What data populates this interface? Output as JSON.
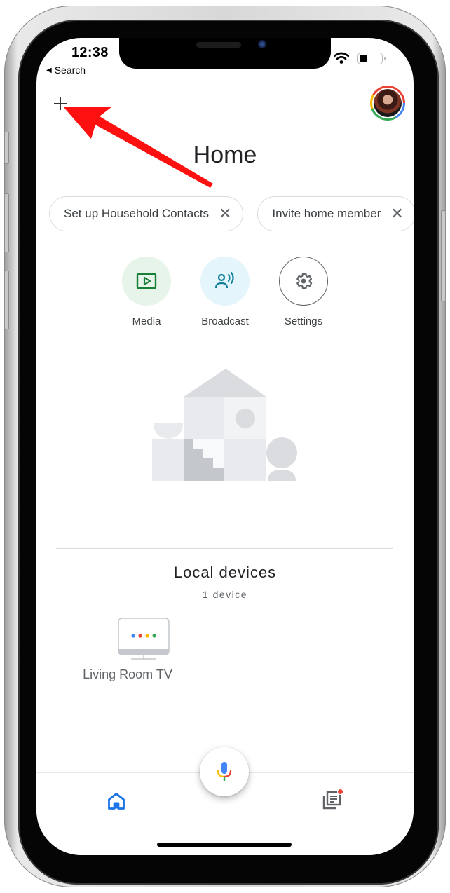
{
  "status_bar": {
    "time": "12:38",
    "back_label": "Search",
    "back_icon": "back-triangle-icon",
    "icons": [
      "wifi-icon",
      "battery-icon"
    ]
  },
  "header": {
    "add_icon": "plus-icon",
    "title": "Home",
    "avatar_icon": "account-avatar",
    "avatar_ring_colors": [
      "#ea4335",
      "#4285f4",
      "#34a853",
      "#fbbc05"
    ]
  },
  "annotation": {
    "type": "arrow",
    "color": "#ff0000",
    "points_to": "add-button"
  },
  "chips": [
    {
      "label": "Set up Household Contacts",
      "dismiss_icon": "close-icon"
    },
    {
      "label": "Invite home member",
      "dismiss_icon": "close-icon"
    }
  ],
  "actions": [
    {
      "label": "Media",
      "icon": "play-screen-icon",
      "color": "#188038",
      "bg": "#e6f4ea"
    },
    {
      "label": "Broadcast",
      "icon": "broadcast-icon",
      "color": "#12809a",
      "bg": "#e4f5fb"
    },
    {
      "label": "Settings",
      "icon": "gear-icon",
      "color": "#5f6368",
      "bg": "#ffffff"
    }
  ],
  "local_devices": {
    "title": "Local devices",
    "count_label": "1 device",
    "devices": [
      {
        "name": "Living Room TV",
        "icon": "tv-icon",
        "dot_colors": [
          "#4285f4",
          "#ea4335",
          "#fbbc05",
          "#34a853"
        ]
      }
    ]
  },
  "bottom_nav": {
    "home_icon": "home-icon",
    "home_color": "#1a73e8",
    "mic_icon": "mic-icon",
    "feed_icon": "feed-icon",
    "feed_badge_color": "#ea4335"
  }
}
